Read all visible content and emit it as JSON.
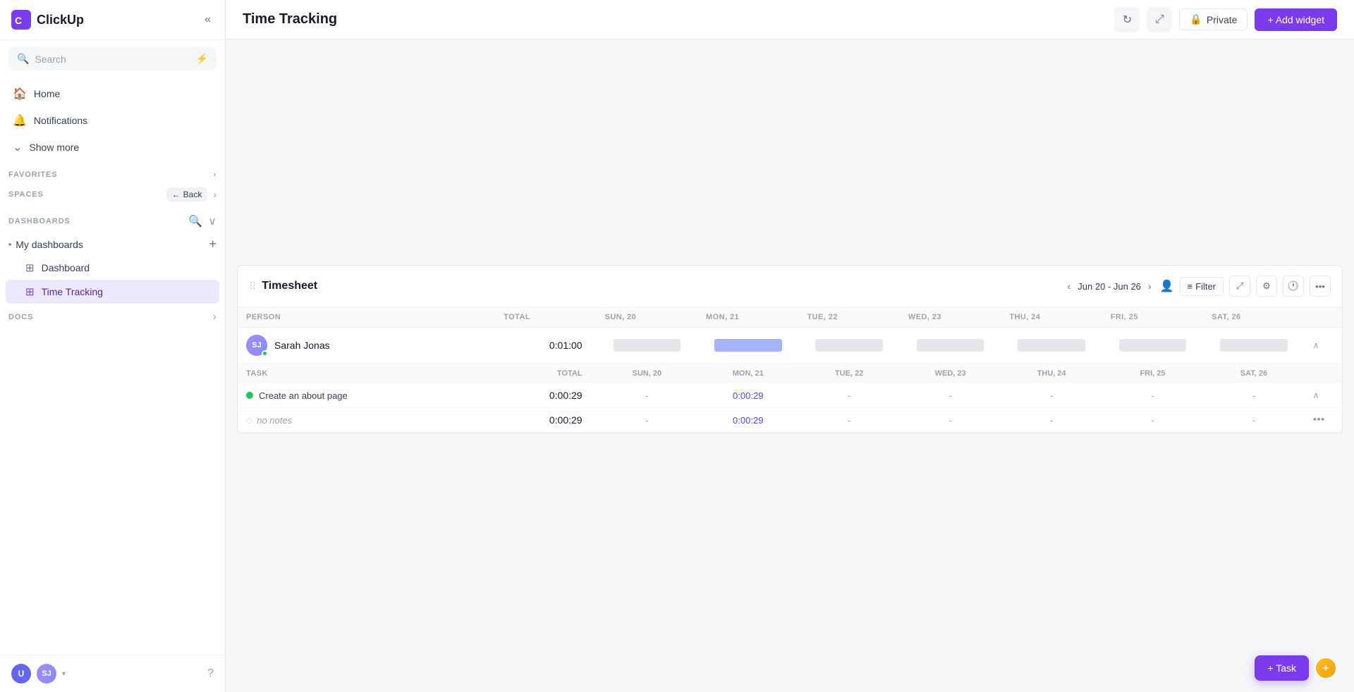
{
  "app": {
    "name": "ClickUp"
  },
  "sidebar": {
    "collapse_label": "«",
    "search_placeholder": "Search",
    "lightning_icon": "⚡",
    "nav_items": [
      {
        "id": "home",
        "label": "Home",
        "icon": "🏠"
      },
      {
        "id": "notifications",
        "label": "Notifications",
        "icon": "🔔"
      },
      {
        "id": "show-more",
        "label": "Show more",
        "icon": "↓"
      }
    ],
    "favorites_label": "FAVORITES",
    "spaces_label": "SPACES",
    "back_label": "Back",
    "dashboards_label": "DASHBOARDS",
    "my_dashboards_label": "My dashboards",
    "sub_items": [
      {
        "id": "dashboard",
        "label": "Dashboard",
        "icon": "⊞",
        "active": false
      },
      {
        "id": "time-tracking",
        "label": "Time Tracking",
        "icon": "⊞",
        "active": true
      }
    ],
    "docs_label": "DOCS",
    "footer": {
      "user_u": "U",
      "user_sj": "SJ",
      "help_icon": "?"
    }
  },
  "topbar": {
    "title": "Time Tracking",
    "refresh_icon": "↻",
    "expand_icon": "⤢",
    "private_label": "Private",
    "lock_icon": "🔒",
    "add_widget_label": "+ Add widget"
  },
  "timesheet": {
    "title": "Timesheet",
    "drag_icon": "⠿",
    "date_prev": "‹",
    "date_range": "Jun 20 - Jun 26",
    "date_next": "›",
    "filter_label": "Filter",
    "columns": {
      "person": "PERSON",
      "total": "TOTAL",
      "sun": "SUN, 20",
      "mon": "MON, 21",
      "tue": "TUE, 22",
      "wed": "WED, 23",
      "thu": "THU, 24",
      "fri": "FRI, 25",
      "sat": "SAT, 26",
      "task": "TASK"
    },
    "person_row": {
      "avatar": "SJ",
      "name": "Sarah Jonas",
      "total": "0:01:00",
      "sun": "bar",
      "mon": "bar-blue",
      "tue": "bar",
      "wed": "bar",
      "thu": "bar",
      "fri": "bar",
      "sat": "bar"
    },
    "task_row": {
      "dot_color": "#22c55e",
      "task_name": "Create an about page",
      "total": "0:00:29",
      "sun": "-",
      "mon": "0:00:29",
      "tue": "-",
      "wed": "-",
      "thu": "-",
      "fri": "-",
      "sat": "-"
    },
    "notes_row": {
      "notes_text": "no notes",
      "total": "0:00:29",
      "sun": "-",
      "mon": "0:00:29",
      "tue": "-",
      "wed": "-",
      "thu": "-",
      "fri": "-",
      "sat": "-"
    }
  },
  "bottom": {
    "add_task_label": "+ Task"
  }
}
